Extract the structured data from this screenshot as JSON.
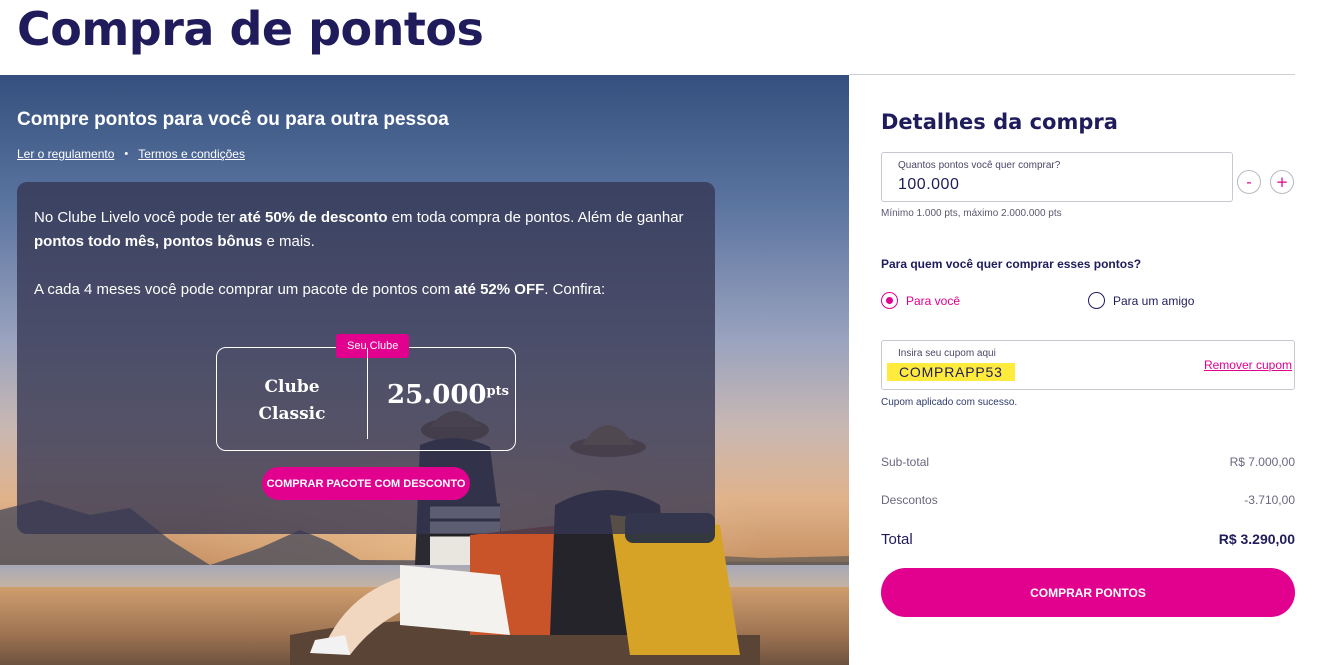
{
  "page": {
    "title": "Compra de pontos"
  },
  "hero": {
    "heading": "Compre pontos para você ou para outra pessoa",
    "links": {
      "rules": "Ler o regulamento",
      "separator": "•",
      "terms": "Termos e condições"
    },
    "info": {
      "p1_a": "No Clube Livelo você pode ter ",
      "p1_b": "até 50% de desconto",
      "p1_c": " em toda compra de pontos. Além de ganhar ",
      "p1_d": "pontos todo mês, pontos bônus",
      "p1_e": " e mais.",
      "p2_a": "A cada 4 meses você pode comprar um pacote de pontos com ",
      "p2_b": "até 52% OFF",
      "p2_c": ". Confira:"
    },
    "club": {
      "badge": "Seu Clube",
      "name_line1": "Clube",
      "name_line2": "Classic",
      "points": "25.000",
      "unit": "pts"
    },
    "pack_button": "COMPRAR PACOTE COM DESCONTO"
  },
  "sidebar": {
    "title": "Detalhes da compra",
    "points_field": {
      "label": "Quantos pontos você quer comprar?",
      "value": "100.000",
      "minus": "-",
      "plus": "+"
    },
    "limits_hint": "Mínimo 1.000 pts, máximo 2.000.000 pts",
    "recipient_question": "Para quem você quer comprar esses pontos?",
    "recipient_options": {
      "you": "Para você",
      "friend": "Para um amigo",
      "selected": "you"
    },
    "coupon": {
      "label": "Insira seu cupom aqui",
      "code": "COMPRAPP53",
      "remove": "Remover cupom",
      "success": "Cupom aplicado com sucesso."
    },
    "summary": {
      "subtotal_label": "Sub-total",
      "subtotal_value": "R$ 7.000,00",
      "discount_label": "Descontos",
      "discount_value": "-3.710,00",
      "total_label": "Total",
      "total_value": "R$ 3.290,00"
    },
    "buy_button": "COMPRAR PONTOS"
  },
  "colors": {
    "brand_magenta": "#e2008f",
    "navy": "#201c5c",
    "coupon_highlight": "#ffeb3b"
  }
}
